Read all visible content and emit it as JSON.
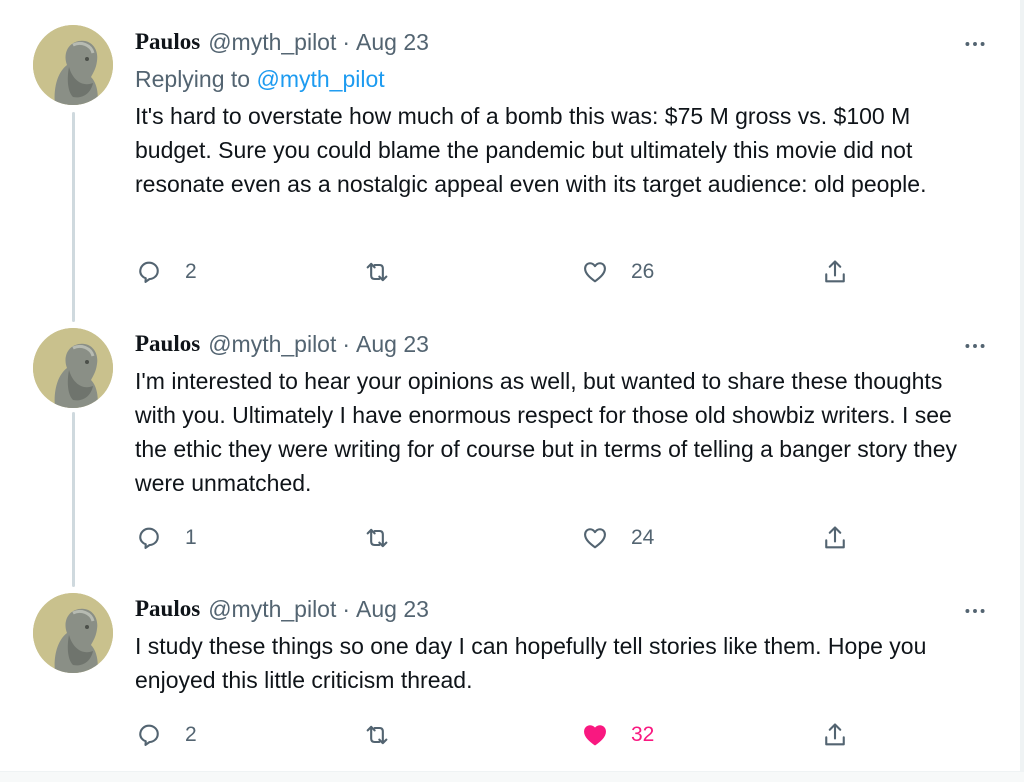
{
  "tweets": [
    {
      "name": "Paulos",
      "handle": "@myth_pilot",
      "separator": "·",
      "date": "Aug 23",
      "replying_prefix": "Replying to",
      "replying_mention": "@myth_pilot",
      "text": "It's hard to overstate how much of a bomb this was: $75 M gross vs. $100 M budget. Sure you could blame the pandemic but ultimately this movie did not resonate even as a nostalgic appeal even with its target audience: old people.",
      "replies": "2",
      "likes": "26",
      "liked": false
    },
    {
      "name": "Paulos",
      "handle": "@myth_pilot",
      "separator": "·",
      "date": "Aug 23",
      "text": "I'm interested to hear your opinions as well, but wanted to share these thoughts with you. Ultimately I have enormous respect for those old showbiz writers. I see the ethic they were writing for of course but in terms of telling a banger story they were unmatched.",
      "replies": "1",
      "likes": "24",
      "liked": false
    },
    {
      "name": "Paulos",
      "handle": "@myth_pilot",
      "separator": "·",
      "date": "Aug 23",
      "text": "I study these things so one day I can hopefully tell stories like them. Hope you enjoyed this little criticism thread.",
      "replies": "2",
      "likes": "32",
      "liked": true
    }
  ],
  "colors": {
    "text": "#0f1419",
    "secondary": "#536471",
    "link": "#1d9bf0",
    "like_active": "#f91880",
    "thread_line": "#cfd9de"
  },
  "icons": [
    "more-icon",
    "reply-icon",
    "retweet-icon",
    "like-icon",
    "share-icon"
  ]
}
